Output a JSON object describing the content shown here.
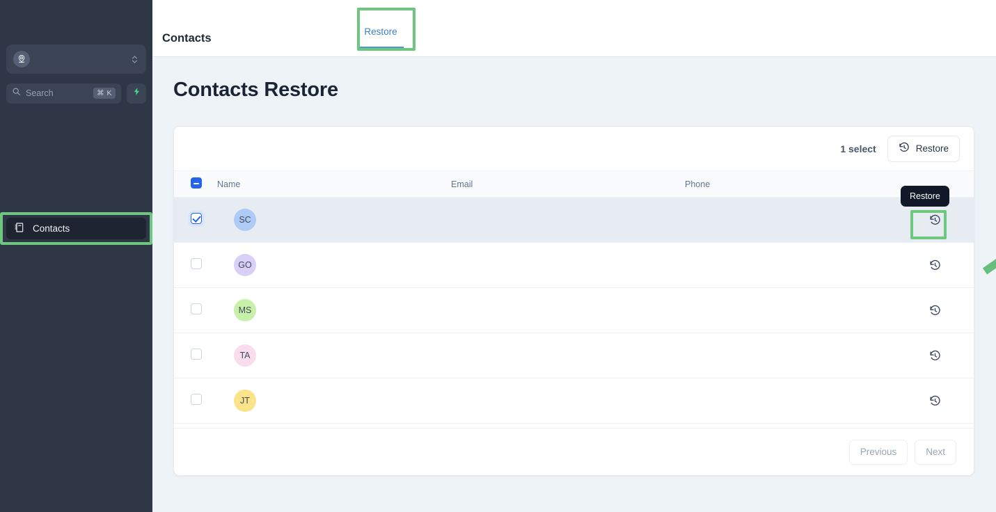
{
  "sidebar": {
    "workspace": {
      "name": "",
      "icon": "location-user-icon"
    },
    "search": {
      "placeholder": "Search",
      "shortcut": "⌘ K",
      "icon": "search-icon"
    },
    "quick_action": {
      "icon": "lightning-bolt-icon"
    },
    "items": [
      {
        "label": "Contacts",
        "icon": "contact-book-icon",
        "active": true
      }
    ]
  },
  "topbar": {
    "title": "Contacts",
    "tabs": [
      {
        "label": "Restore",
        "active": true
      }
    ]
  },
  "page": {
    "title": "Contacts Restore"
  },
  "toolbar": {
    "select_count": "1 select",
    "restore_label": "Restore",
    "restore_icon": "restore-clock-icon"
  },
  "table": {
    "columns": [
      "Name",
      "Email",
      "Phone"
    ],
    "header_checkbox_state": "indeterminate",
    "rows": [
      {
        "initials": "SC",
        "avatar_color": "#aecbf5",
        "name": "",
        "email": "",
        "phone": "",
        "selected": true,
        "action_icon": "restore-clock-icon"
      },
      {
        "initials": "GO",
        "avatar_color": "#d8d0f7",
        "name": "",
        "email": "",
        "phone": "",
        "selected": false,
        "action_icon": "restore-clock-icon"
      },
      {
        "initials": "MS",
        "avatar_color": "#c7f0a8",
        "name": "",
        "email": "",
        "phone": "",
        "selected": false,
        "action_icon": "restore-clock-icon"
      },
      {
        "initials": "TA",
        "avatar_color": "#f9dced",
        "name": "",
        "email": "",
        "phone": "",
        "selected": false,
        "action_icon": "restore-clock-icon"
      },
      {
        "initials": "JT",
        "avatar_color": "#fbe38a",
        "name": "",
        "email": "",
        "phone": "",
        "selected": false,
        "action_icon": "restore-clock-icon"
      }
    ]
  },
  "pagination": {
    "previous": "Previous",
    "next": "Next"
  },
  "annotations": {
    "tooltip_text": "Restore",
    "highlight_color": "#6ec77f",
    "arrow_color": "#68be7c"
  },
  "colors": {
    "sidebar_bg": "#2f3747",
    "page_bg": "#eef3f7",
    "accent_blue": "#2563eb",
    "tab_blue": "#3b82c4"
  }
}
